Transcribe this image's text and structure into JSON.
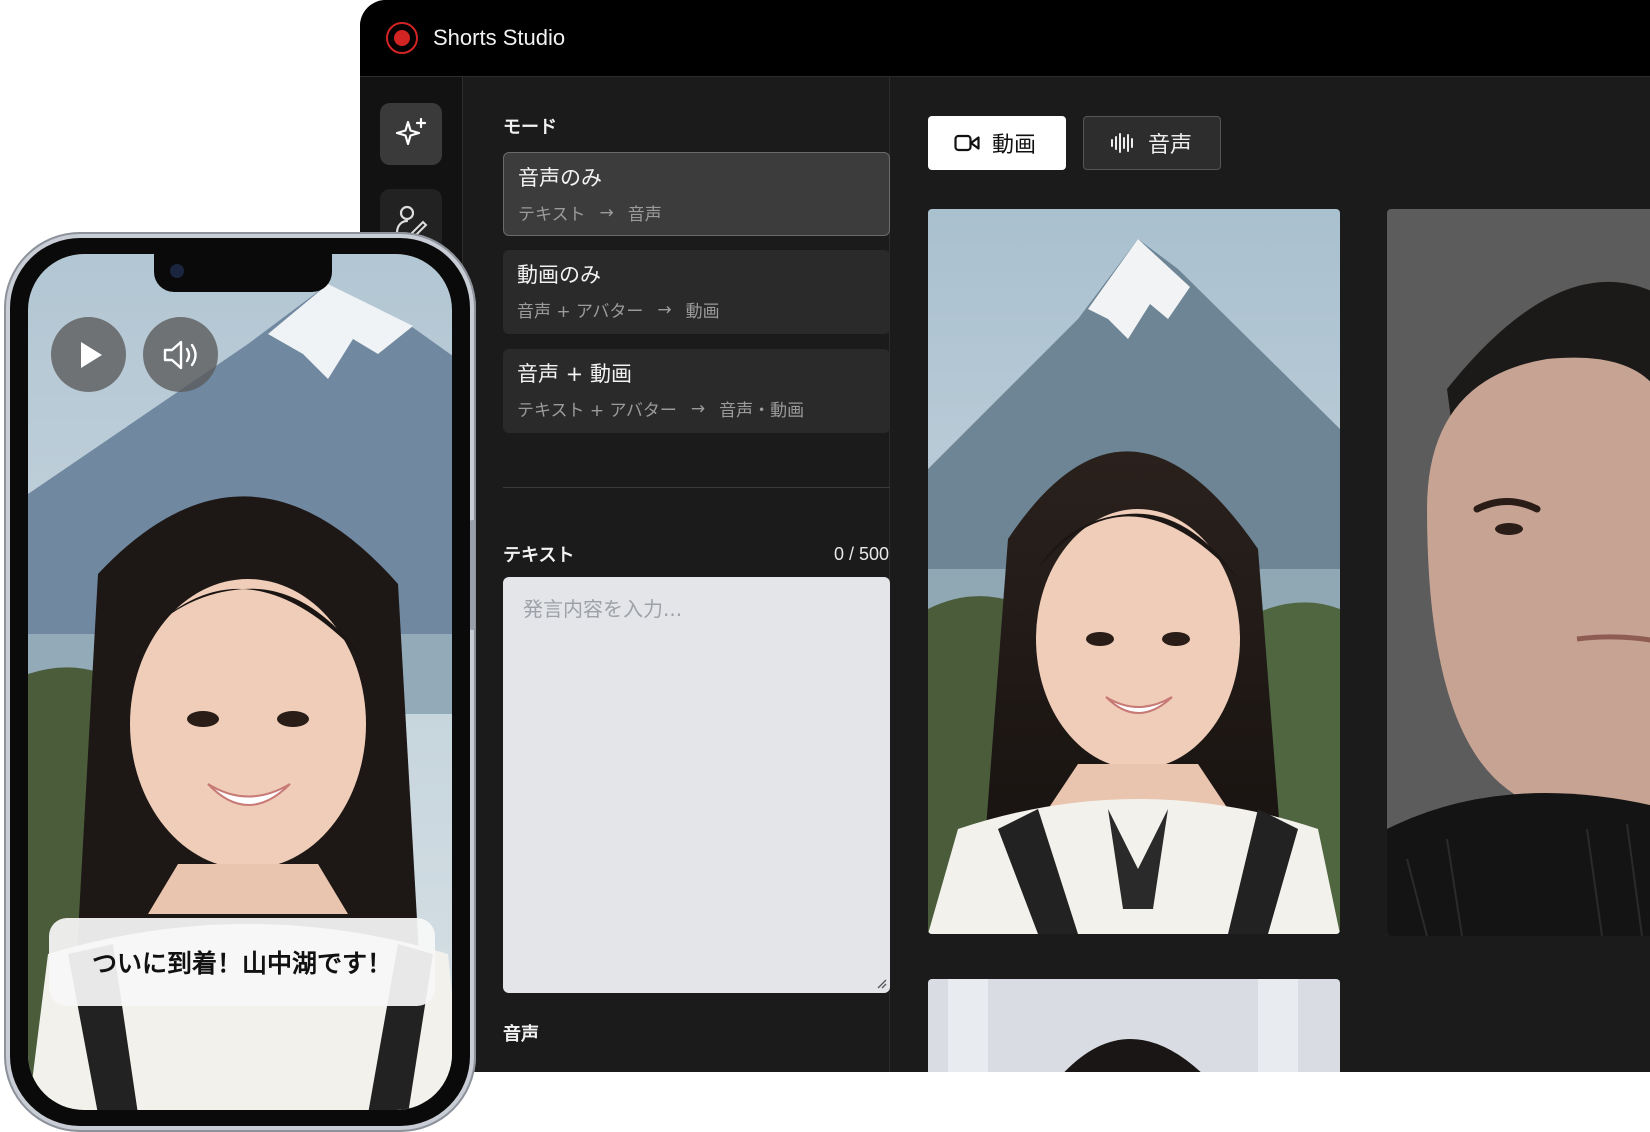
{
  "app": {
    "title": "Shorts Studio"
  },
  "form": {
    "mode_label": "モード",
    "modes": [
      {
        "title": "音声のみ",
        "from": "テキスト",
        "to": "音声",
        "active": true
      },
      {
        "title": "動画のみ",
        "from": "音声 + アバター",
        "to": "動画",
        "active": false
      },
      {
        "title": "音声 + 動画",
        "from": "テキスト + アバター",
        "to": "音声・動画",
        "active": false
      }
    ],
    "text_label": "テキスト",
    "text_counter": "0 / 500",
    "text_placeholder": "発言内容を入力...",
    "voice_label": "音声"
  },
  "gallery": {
    "tabs": [
      {
        "label": "動画",
        "icon": "video-camera-icon",
        "selected": true
      },
      {
        "label": "音声",
        "icon": "waveform-icon",
        "selected": false
      }
    ]
  },
  "phone": {
    "caption": "ついに到着！山中湖です！"
  },
  "colors": {
    "accent": "#d32424",
    "panel": "#1b1b1b",
    "titlebar": "#000000"
  }
}
